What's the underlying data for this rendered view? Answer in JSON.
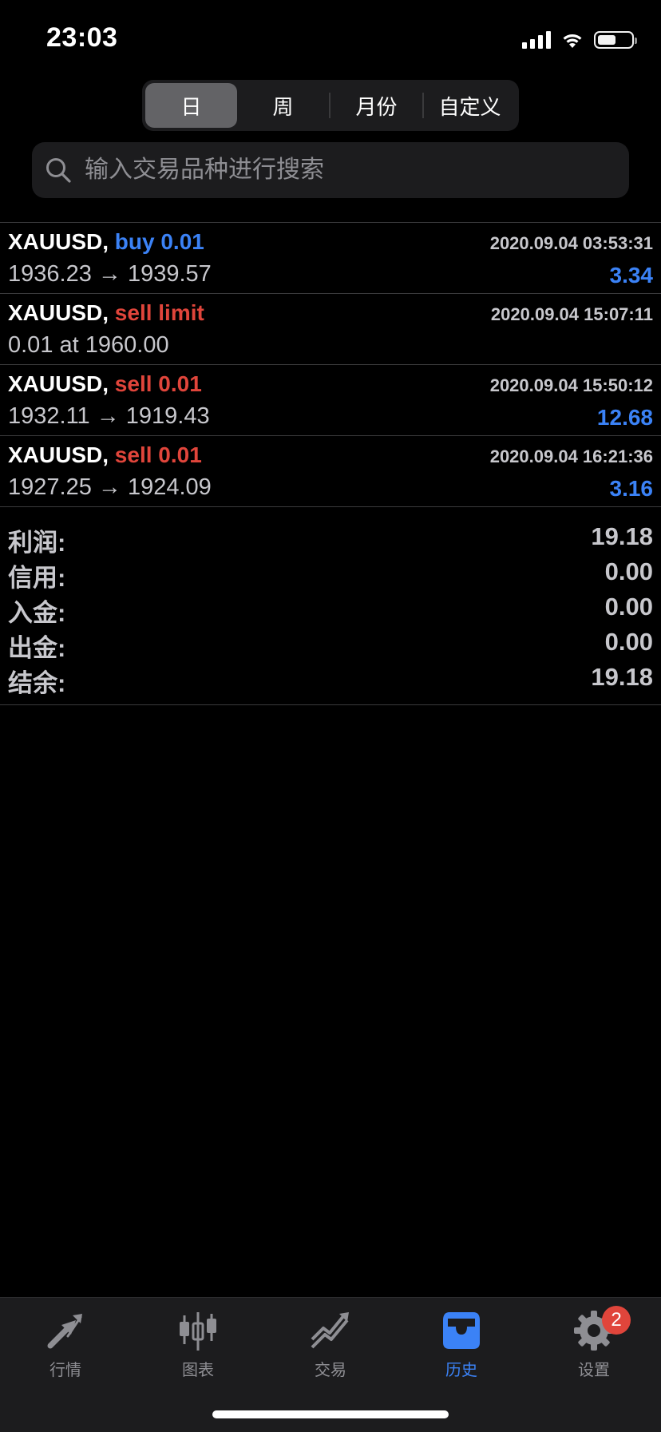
{
  "status": {
    "time": "23:03"
  },
  "segments": [
    {
      "label": "日",
      "active": true
    },
    {
      "label": "周"
    },
    {
      "label": "月份"
    },
    {
      "label": "自定义"
    }
  ],
  "search": {
    "placeholder": "输入交易品种进行搜索"
  },
  "orders": [
    {
      "symbol": "XAUUSD,",
      "action": "buy 0.01",
      "side": "buy",
      "time": "2020.09.04 03:53:31",
      "prices": "1936.23 → 1939.57",
      "profit": "3.34"
    },
    {
      "symbol": "XAUUSD,",
      "action": "sell limit",
      "side": "sell",
      "time": "2020.09.04 15:07:11",
      "prices": "0.01 at 1960.00",
      "profit": ""
    },
    {
      "symbol": "XAUUSD,",
      "action": "sell 0.01",
      "side": "sell",
      "time": "2020.09.04 15:50:12",
      "prices": "1932.11 → 1919.43",
      "profit": "12.68"
    },
    {
      "symbol": "XAUUSD,",
      "action": "sell 0.01",
      "side": "sell",
      "time": "2020.09.04 16:21:36",
      "prices": "1927.25 → 1924.09",
      "profit": "3.16"
    }
  ],
  "summary": [
    {
      "label": "利润:",
      "value": "19.18"
    },
    {
      "label": "信用:",
      "value": "0.00"
    },
    {
      "label": "入金:",
      "value": "0.00"
    },
    {
      "label": "出金:",
      "value": "0.00"
    },
    {
      "label": "结余:",
      "value": "19.18"
    }
  ],
  "tabs": [
    {
      "label": "行情",
      "icon": "quotes-arrows-icon"
    },
    {
      "label": "图表",
      "icon": "candlestick-chart-icon"
    },
    {
      "label": "交易",
      "icon": "trade-trend-icon"
    },
    {
      "label": "历史",
      "icon": "history-inbox-icon",
      "active": true
    },
    {
      "label": "设置",
      "icon": "settings-gear-icon",
      "badge": "2"
    }
  ],
  "colors": {
    "accent": "#3b82f6",
    "sell": "#e0453b",
    "background": "#000000",
    "panel": "#1c1c1e"
  }
}
